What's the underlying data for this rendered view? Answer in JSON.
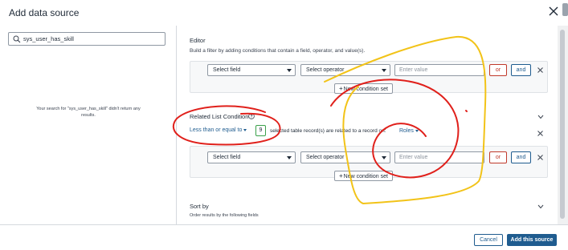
{
  "dialog": {
    "title": "Add data source"
  },
  "search": {
    "value": "sys_user_has_skill",
    "empty_message": "Your search for \"sys_user_has_skill\" didn't return any results."
  },
  "editor": {
    "title": "Editor",
    "subtitle": "Build a filter by adding conditions that contain a field, operator, and value(s).",
    "condition": {
      "field": "Select field",
      "operator": "Select operator",
      "value_placeholder": "Enter value",
      "or": "or",
      "and": "and"
    },
    "new_condition_set": "New condition set"
  },
  "related_list": {
    "title": "Related List Condition",
    "quantifier": "Less than or equal to",
    "count": "9",
    "sentence": "selected table record(s) are related to a record on:",
    "table": "Roles",
    "condition": {
      "field": "Select field",
      "operator": "Select operator",
      "value_placeholder": "Enter value",
      "or": "or",
      "and": "and"
    },
    "new_condition_set": "New condition set"
  },
  "sort": {
    "title": "Sort by",
    "subtitle": "Order results by the following fields"
  },
  "footer": {
    "cancel": "Cancel",
    "add": "Add this source"
  },
  "colors": {
    "accent": "#1f5c8f",
    "danger": "#c0392b",
    "annotation_red": "#e0201b",
    "annotation_yellow": "#f2c318",
    "count_border": "#3aa04a"
  },
  "icons": [
    "close-icon",
    "search-icon",
    "help-icon",
    "chevron-down-icon",
    "remove-icon",
    "plus-icon"
  ]
}
